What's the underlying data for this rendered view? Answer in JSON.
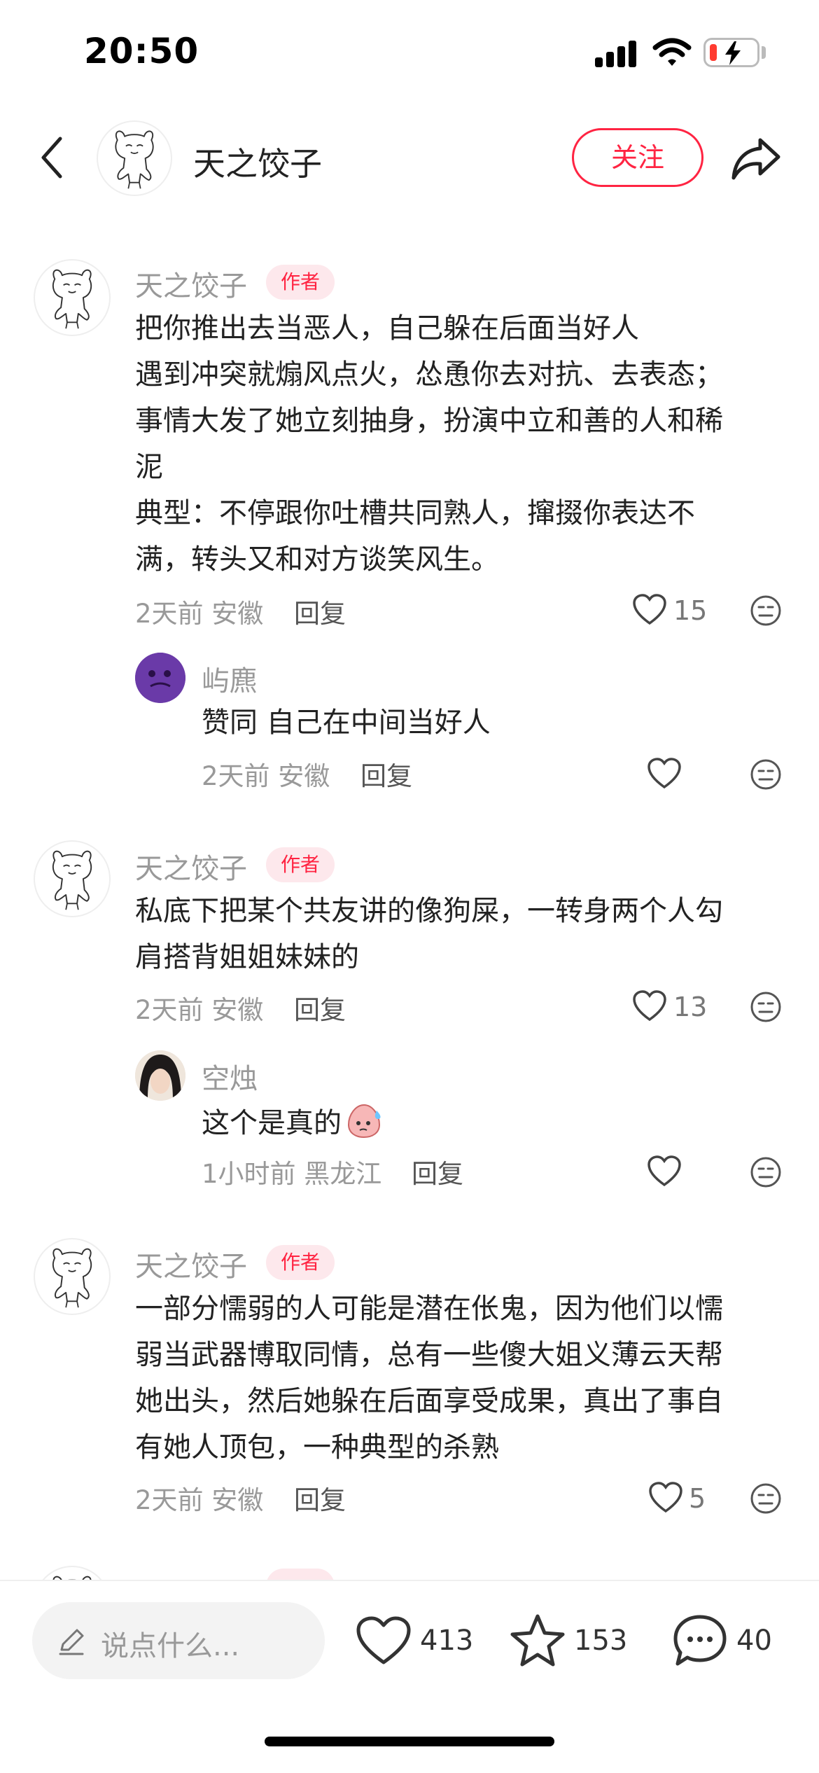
{
  "status_bar": {
    "time": "20:50"
  },
  "header": {
    "name": "天之饺子",
    "follow_label": "关注"
  },
  "comments": [
    {
      "author": "天之饺子",
      "tag": "作者",
      "text": "把你推出去当恶人，自己躲在后面当好人\n遇到冲突就煽风点火，怂恿你去对抗、去表态；\n事情大发了她立刻抽身，扮演中立和善的人和稀\n泥\n典型：不停跟你吐槽共同熟人，撺掇你表达不\n满，转头又和对方谈笑风生。",
      "meta": "2天前 安徽",
      "reply_label": "回复",
      "likes": "15",
      "replies": [
        {
          "author": "屿麃",
          "text": "赞同 自己在中间当好人",
          "meta": "2天前 安徽",
          "reply_label": "回复"
        }
      ]
    },
    {
      "author": "天之饺子",
      "tag": "作者",
      "text": "私底下把某个共友讲的像狗屎，一转身两个人勾\n肩搭背姐姐妹妹的",
      "meta": "2天前 安徽",
      "reply_label": "回复",
      "likes": "13",
      "replies": [
        {
          "author": "空烛",
          "text": "这个是真的",
          "meta": "1小时前 黑龙江",
          "reply_label": "回复"
        }
      ]
    },
    {
      "author": "天之饺子",
      "tag": "作者",
      "text": "一部分懦弱的人可能是潜在伥鬼，因为他们以懦\n弱当武器博取同情，总有一些傻大姐义薄云天帮\n她出头，然后她躲在后面享受成果，真出了事自\n有她人顶包，一种典型的杀熟",
      "meta": "2天前 安徽",
      "reply_label": "回复",
      "likes": "5"
    }
  ],
  "bottom_bar": {
    "input_placeholder": "说点什么...",
    "likes": "413",
    "stars": "153",
    "comments": "40"
  },
  "colors": {
    "accent": "#ff2442",
    "tag_bg": "#fde8ec",
    "muted": "#999999"
  },
  "icons": [
    "back-icon",
    "share-icon",
    "heart-icon",
    "dislike-icon",
    "star-icon",
    "comment-icon",
    "pen-icon"
  ]
}
